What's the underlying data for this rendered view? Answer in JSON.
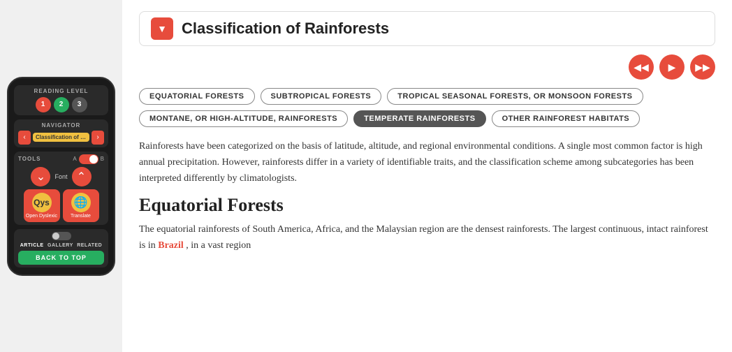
{
  "device": {
    "reading_level_label": "READING LEVEL",
    "level1": "1",
    "level2": "2",
    "level3": "3",
    "navigator_label": "NAVIGATOR",
    "nav_title": "Classification of R...",
    "tools_label": "TOOLS",
    "tools_a": "A",
    "tools_b": "B",
    "font_label": "Font",
    "open_dyslexic_label": "Open Dyslexic",
    "translate_label": "Translate",
    "open_dyslexic_text": "Qys",
    "article_tab": "ARTICLE",
    "gallery_tab": "GALLERY",
    "related_tab": "RELATED",
    "back_to_top": "BACK TO TOP"
  },
  "header": {
    "title": "Classification of Rainforests"
  },
  "tags": [
    {
      "label": "EQUATORIAL FORESTS",
      "active": false
    },
    {
      "label": "SUBTROPICAL FORESTS",
      "active": false
    },
    {
      "label": "TROPICAL SEASONAL FORESTS, OR MONSOON FORESTS",
      "active": false
    },
    {
      "label": "MONTANE, OR HIGH-ALTITUDE, RAINFORESTS",
      "active": false
    },
    {
      "label": "TEMPERATE RAINFORESTS",
      "active": true
    },
    {
      "label": "OTHER RAINFOREST HABITATS",
      "active": false
    }
  ],
  "body_paragraph": "Rainforests have been categorized on the basis of latitude, altitude, and regional environmental conditions. A single most common factor is high annual precipitation. However, rainforests differ in a variety of identifiable traits, and the classification scheme among subcategories has been interpreted differently by climatologists.",
  "section_title": "Equatorial Forests",
  "section_paragraph": "The equatorial rainforests of South America, Africa, and the Malaysian region are the densest rainforests. The largest continuous, intact rainforest is in Brazil, in a vast region",
  "link_word": "Brazil",
  "media_controls": {
    "rewind": "⏮",
    "play": "▶",
    "forward": "⏭"
  }
}
